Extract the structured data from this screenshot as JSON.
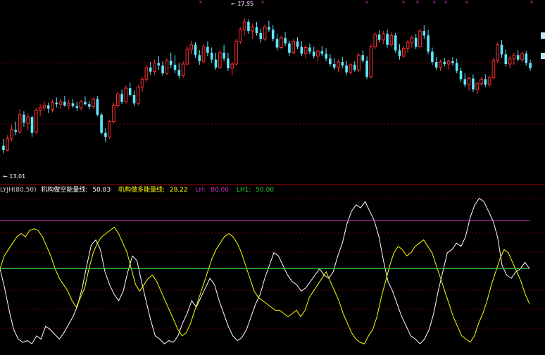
{
  "chart_data": [
    {
      "type": "candlestick",
      "panel": "price",
      "title": "",
      "annotations": {
        "high_label": "17.55",
        "low_label": "13.01"
      },
      "ylim": [
        12.8,
        18.0
      ],
      "grid": true,
      "colors": {
        "up": "#ff3030",
        "down": "#5fe8ff",
        "grid": "#7a0000",
        "background": "#000000"
      },
      "candles": {
        "fields": [
          "open",
          "high",
          "low",
          "close"
        ],
        "data": [
          [
            13.85,
            14.05,
            13.62,
            13.72
          ],
          [
            13.72,
            14.15,
            13.68,
            14.05
          ],
          [
            14.05,
            14.45,
            13.98,
            14.32
          ],
          [
            14.3,
            14.55,
            14.15,
            14.25
          ],
          [
            14.25,
            14.9,
            14.2,
            14.75
          ],
          [
            14.75,
            14.85,
            14.4,
            14.52
          ],
          [
            14.5,
            14.78,
            14.3,
            14.68
          ],
          [
            14.68,
            14.72,
            14.1,
            14.22
          ],
          [
            14.25,
            14.95,
            14.18,
            14.88
          ],
          [
            14.88,
            15.05,
            14.7,
            14.95
          ],
          [
            14.95,
            15.15,
            14.85,
            15.02
          ],
          [
            15.02,
            15.1,
            14.8,
            14.92
          ],
          [
            14.9,
            15.18,
            14.82,
            15.1
          ],
          [
            15.1,
            15.25,
            14.96,
            15.05
          ],
          [
            15.05,
            15.22,
            14.92,
            15.12
          ],
          [
            15.12,
            15.3,
            14.98,
            15.02
          ],
          [
            15.02,
            15.18,
            14.9,
            15.08
          ],
          [
            15.08,
            15.2,
            14.95,
            15.0
          ],
          [
            15.0,
            15.12,
            14.86,
            14.95
          ],
          [
            14.95,
            15.18,
            14.88,
            15.12
          ],
          [
            15.12,
            15.28,
            15.02,
            15.05
          ],
          [
            15.05,
            15.15,
            14.9,
            14.98
          ],
          [
            14.98,
            15.25,
            14.92,
            15.2
          ],
          [
            15.2,
            15.3,
            14.7,
            14.75
          ],
          [
            14.75,
            14.8,
            14.18,
            14.22
          ],
          [
            14.22,
            14.35,
            13.95,
            14.1
          ],
          [
            14.1,
            14.6,
            14.05,
            14.55
          ],
          [
            14.55,
            15.1,
            14.5,
            15.02
          ],
          [
            15.02,
            15.42,
            14.95,
            15.35
          ],
          [
            15.35,
            15.48,
            15.05,
            15.12
          ],
          [
            15.12,
            15.6,
            15.08,
            15.52
          ],
          [
            15.52,
            15.68,
            15.28,
            15.32
          ],
          [
            15.32,
            15.45,
            15.0,
            15.08
          ],
          [
            15.08,
            15.62,
            15.02,
            15.55
          ],
          [
            15.55,
            15.85,
            15.42,
            15.78
          ],
          [
            15.78,
            16.2,
            15.7,
            16.12
          ],
          [
            16.12,
            16.28,
            15.9,
            16.0
          ],
          [
            16.0,
            16.35,
            15.92,
            16.25
          ],
          [
            16.25,
            16.45,
            16.05,
            16.18
          ],
          [
            16.18,
            16.3,
            15.88,
            15.95
          ],
          [
            15.95,
            16.4,
            15.9,
            16.32
          ],
          [
            16.32,
            16.55,
            16.1,
            16.2
          ],
          [
            16.2,
            16.48,
            15.95,
            16.05
          ],
          [
            16.05,
            16.25,
            15.8,
            15.88
          ],
          [
            15.88,
            16.3,
            15.82,
            16.22
          ],
          [
            16.22,
            16.75,
            16.18,
            16.65
          ],
          [
            16.65,
            16.9,
            16.5,
            16.78
          ],
          [
            16.78,
            16.85,
            16.4,
            16.48
          ],
          [
            16.48,
            16.62,
            16.2,
            16.3
          ],
          [
            16.3,
            16.8,
            16.25,
            16.72
          ],
          [
            16.72,
            16.88,
            16.45,
            16.55
          ],
          [
            16.55,
            16.7,
            16.25,
            16.35
          ],
          [
            16.35,
            16.55,
            16.05,
            16.12
          ],
          [
            16.12,
            16.62,
            16.08,
            16.55
          ],
          [
            16.55,
            16.78,
            16.3,
            16.38
          ],
          [
            16.38,
            16.55,
            16.02,
            16.1
          ],
          [
            16.1,
            16.28,
            15.9,
            16.22
          ],
          [
            16.22,
            16.95,
            16.18,
            16.88
          ],
          [
            16.88,
            17.3,
            16.8,
            17.22
          ],
          [
            17.22,
            17.55,
            17.05,
            17.45
          ],
          [
            17.45,
            17.52,
            17.1,
            17.18
          ],
          [
            17.18,
            17.4,
            16.95,
            17.3
          ],
          [
            17.3,
            17.45,
            17.05,
            17.12
          ],
          [
            17.12,
            17.25,
            16.85,
            16.95
          ],
          [
            16.95,
            17.38,
            16.9,
            17.3
          ],
          [
            17.3,
            17.48,
            17.15,
            17.22
          ],
          [
            17.22,
            17.35,
            16.88,
            16.95
          ],
          [
            16.95,
            17.1,
            16.62,
            16.7
          ],
          [
            16.7,
            17.05,
            16.65,
            16.98
          ],
          [
            16.98,
            17.15,
            16.75,
            16.82
          ],
          [
            16.82,
            16.9,
            16.45,
            16.55
          ],
          [
            16.55,
            16.95,
            16.5,
            16.88
          ],
          [
            16.88,
            17.0,
            16.65,
            16.72
          ],
          [
            16.72,
            16.88,
            16.45,
            16.52
          ],
          [
            16.52,
            16.78,
            16.4,
            16.7
          ],
          [
            16.7,
            16.82,
            16.5,
            16.58
          ],
          [
            16.58,
            16.72,
            16.38,
            16.45
          ],
          [
            16.45,
            16.65,
            16.3,
            16.6
          ],
          [
            16.6,
            16.75,
            16.45,
            16.52
          ],
          [
            16.52,
            16.68,
            16.3,
            16.38
          ],
          [
            16.38,
            16.5,
            16.15,
            16.22
          ],
          [
            16.22,
            16.4,
            16.05,
            16.12
          ],
          [
            16.12,
            16.35,
            15.98,
            16.28
          ],
          [
            16.28,
            16.42,
            16.1,
            16.18
          ],
          [
            16.18,
            16.3,
            15.9,
            15.98
          ],
          [
            15.98,
            16.25,
            15.92,
            16.2
          ],
          [
            16.2,
            16.3,
            16.0,
            16.05
          ],
          [
            16.05,
            16.55,
            16.0,
            16.48
          ],
          [
            16.48,
            16.62,
            16.25,
            16.32
          ],
          [
            16.32,
            16.45,
            15.78,
            15.85
          ],
          [
            15.85,
            16.8,
            15.8,
            16.72
          ],
          [
            16.72,
            17.15,
            16.65,
            17.08
          ],
          [
            17.08,
            17.2,
            16.85,
            16.92
          ],
          [
            16.92,
            17.18,
            16.8,
            17.1
          ],
          [
            17.1,
            17.22,
            16.7,
            16.78
          ],
          [
            16.78,
            17.15,
            16.72,
            17.05
          ],
          [
            17.05,
            17.12,
            16.55,
            16.62
          ],
          [
            16.62,
            16.8,
            16.35,
            16.45
          ],
          [
            16.45,
            16.75,
            16.4,
            16.68
          ],
          [
            16.68,
            16.92,
            16.55,
            16.85
          ],
          [
            16.85,
            17.05,
            16.7,
            16.98
          ],
          [
            16.98,
            17.1,
            16.65,
            16.72
          ],
          [
            16.72,
            17.25,
            16.68,
            17.18
          ],
          [
            17.18,
            17.35,
            16.95,
            17.05
          ],
          [
            17.05,
            17.22,
            16.5,
            16.58
          ],
          [
            16.58,
            16.7,
            16.2,
            16.28
          ],
          [
            16.28,
            16.42,
            16.05,
            16.12
          ],
          [
            16.12,
            16.35,
            16.02,
            16.28
          ],
          [
            16.28,
            16.4,
            16.15,
            16.22
          ],
          [
            16.22,
            16.35,
            16.05,
            16.3
          ],
          [
            16.3,
            16.42,
            16.18,
            16.25
          ],
          [
            16.25,
            16.38,
            15.95,
            16.02
          ],
          [
            16.02,
            16.12,
            15.7,
            15.78
          ],
          [
            15.78,
            15.95,
            15.55,
            15.62
          ],
          [
            15.62,
            15.85,
            15.45,
            15.8
          ],
          [
            15.8,
            15.92,
            15.4,
            15.48
          ],
          [
            15.48,
            15.7,
            15.35,
            15.65
          ],
          [
            15.65,
            15.85,
            15.6,
            15.78
          ],
          [
            15.78,
            15.92,
            15.55,
            15.62
          ],
          [
            15.62,
            15.88,
            15.55,
            15.82
          ],
          [
            15.82,
            16.4,
            15.78,
            16.32
          ],
          [
            16.32,
            16.85,
            16.25,
            16.78
          ],
          [
            16.78,
            16.92,
            16.4,
            16.5
          ],
          [
            16.5,
            16.65,
            16.15,
            16.22
          ],
          [
            16.22,
            16.45,
            16.1,
            16.38
          ],
          [
            16.38,
            16.55,
            16.2,
            16.48
          ],
          [
            16.48,
            16.62,
            16.3,
            16.35
          ],
          [
            16.35,
            16.58,
            16.28,
            16.52
          ],
          [
            16.52,
            16.6,
            16.18,
            16.25
          ],
          [
            16.25,
            16.35,
            16.02,
            16.1
          ]
        ]
      }
    },
    {
      "type": "line",
      "panel": "indicator",
      "title": "",
      "ylim": [
        0,
        100
      ],
      "grid": true,
      "legend": {
        "name": "LYJH(80,50)",
        "items": [
          {
            "label": "机构做空能量线:",
            "value": "50.83",
            "color": "#ffffff"
          },
          {
            "label": "机构做多能量线:",
            "value": "28.22",
            "color": "#ffff00"
          },
          {
            "label": "LH:",
            "value": "80.00",
            "color": "#cc33cc"
          },
          {
            "label": "LH1:",
            "value": "50.00",
            "color": "#33cc33"
          }
        ]
      },
      "series": [
        {
          "name": "机构做空能量线",
          "color": "#ffffff",
          "values": [
            50,
            38,
            24,
            12,
            6,
            4,
            5,
            3,
            8,
            6,
            14,
            12,
            9,
            6,
            10,
            15,
            20,
            27,
            38,
            52,
            65,
            68,
            62,
            48,
            40,
            34,
            30,
            36,
            48,
            58,
            55,
            42,
            30,
            18,
            8,
            6,
            3,
            5,
            4,
            8,
            16,
            22,
            30,
            26,
            32,
            38,
            44,
            40,
            30,
            22,
            14,
            8,
            5,
            7,
            12,
            20,
            28,
            34,
            44,
            52,
            60,
            58,
            52,
            46,
            42,
            40,
            36,
            38,
            42,
            46,
            50,
            46,
            44,
            48,
            58,
            66,
            78,
            86,
            90,
            88,
            92,
            86,
            80,
            70,
            55,
            42,
            36,
            28,
            20,
            14,
            8,
            6,
            3,
            6,
            12,
            22,
            36,
            48,
            60,
            62,
            66,
            64,
            70,
            82,
            90,
            94,
            92,
            86,
            80,
            70,
            52,
            46,
            44,
            48,
            50,
            54,
            50
          ]
        },
        {
          "name": "机构做多能量线",
          "color": "#ffff00",
          "values": [
            50,
            58,
            62,
            66,
            70,
            72,
            70,
            74,
            75,
            74,
            70,
            64,
            58,
            50,
            44,
            40,
            36,
            30,
            26,
            32,
            38,
            50,
            60,
            66,
            70,
            72,
            74,
            76,
            72,
            66,
            60,
            50,
            40,
            36,
            40,
            44,
            46,
            42,
            36,
            30,
            24,
            18,
            12,
            8,
            10,
            16,
            24,
            32,
            40,
            48,
            56,
            62,
            66,
            70,
            72,
            70,
            66,
            60,
            52,
            44,
            36,
            32,
            30,
            28,
            26,
            24,
            24,
            22,
            20,
            22,
            24,
            20,
            24,
            32,
            36,
            40,
            44,
            48,
            42,
            36,
            30,
            22,
            16,
            10,
            6,
            4,
            3,
            8,
            12,
            20,
            32,
            42,
            52,
            60,
            64,
            62,
            58,
            60,
            64,
            66,
            68,
            64,
            60,
            52,
            44,
            36,
            28,
            20,
            14,
            8,
            6,
            4,
            8,
            16,
            22,
            30,
            40,
            48,
            56,
            62,
            60,
            54,
            48,
            42,
            34,
            28
          ]
        },
        {
          "name": "LH",
          "color": "#cc33cc",
          "values": [
            80,
            80
          ]
        },
        {
          "name": "LH1",
          "color": "#33cc33",
          "values": [
            50,
            50
          ]
        }
      ]
    }
  ]
}
